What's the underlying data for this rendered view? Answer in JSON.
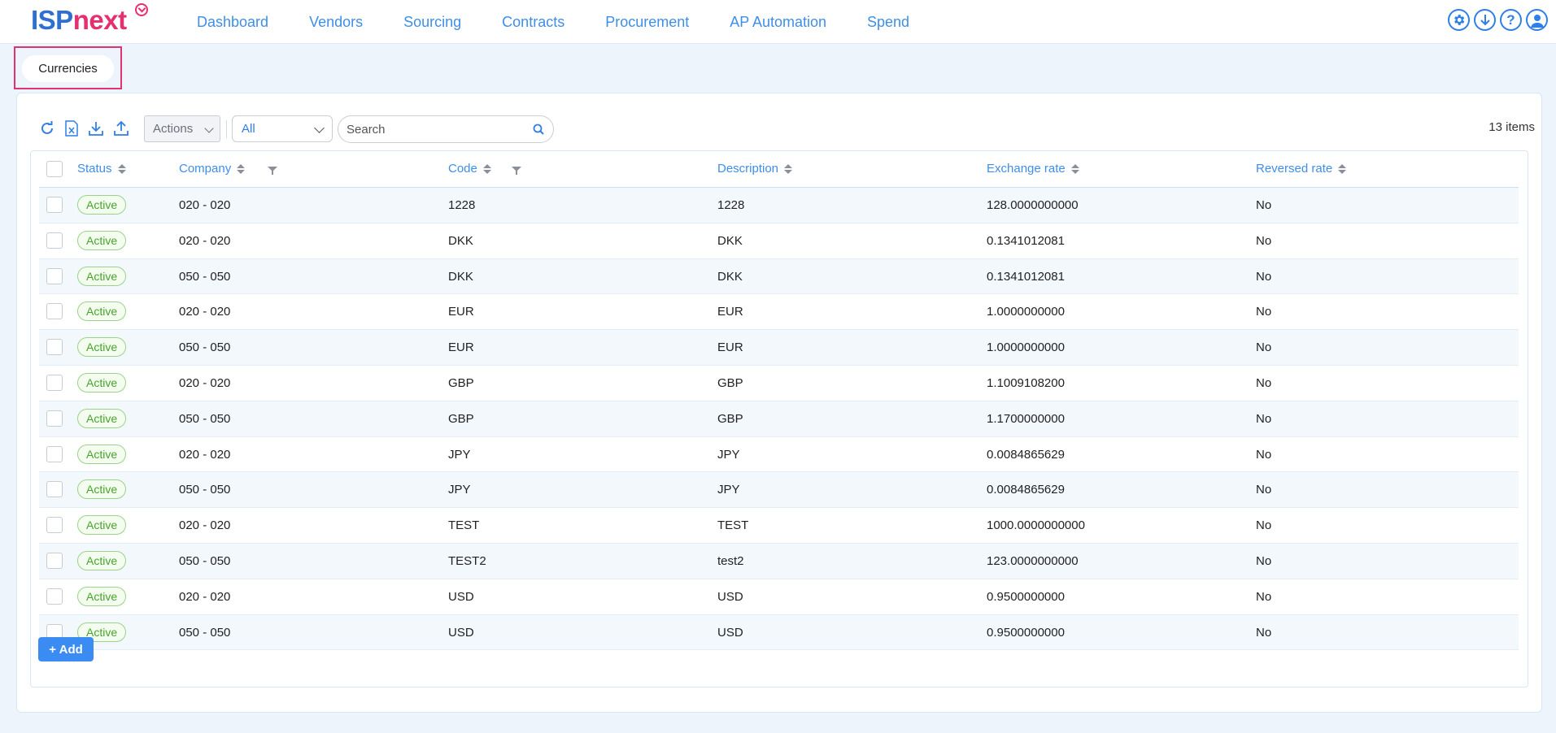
{
  "brand": {
    "part1": "ISP",
    "part2": "next"
  },
  "nav": [
    "Dashboard",
    "Vendors",
    "Sourcing",
    "Contracts",
    "Procurement",
    "AP Automation",
    "Spend"
  ],
  "top_icons": [
    "gear-icon",
    "download-circle-icon",
    "help-icon",
    "user-icon"
  ],
  "page_tab": "Currencies",
  "toolbar": {
    "actions_label": "Actions",
    "filter_value": "All",
    "search_placeholder": "Search",
    "items_count": "13 items",
    "icons": [
      "refresh-icon",
      "excel-export-icon",
      "download-icon",
      "upload-icon"
    ]
  },
  "table": {
    "columns": [
      "Status",
      "Company",
      "Code",
      "Description",
      "Exchange rate",
      "Reversed rate"
    ],
    "rows": [
      [
        "Active",
        "020 - 020",
        "1228",
        "1228",
        "128.0000000000",
        "No"
      ],
      [
        "Active",
        "020 - 020",
        "DKK",
        "DKK",
        "0.1341012081",
        "No"
      ],
      [
        "Active",
        "050 - 050",
        "DKK",
        "DKK",
        "0.1341012081",
        "No"
      ],
      [
        "Active",
        "020 - 020",
        "EUR",
        "EUR",
        "1.0000000000",
        "No"
      ],
      [
        "Active",
        "050 - 050",
        "EUR",
        "EUR",
        "1.0000000000",
        "No"
      ],
      [
        "Active",
        "020 - 020",
        "GBP",
        "GBP",
        "1.1009108200",
        "No"
      ],
      [
        "Active",
        "050 - 050",
        "GBP",
        "GBP",
        "1.1700000000",
        "No"
      ],
      [
        "Active",
        "020 - 020",
        "JPY",
        "JPY",
        "0.0084865629",
        "No"
      ],
      [
        "Active",
        "050 - 050",
        "JPY",
        "JPY",
        "0.0084865629",
        "No"
      ],
      [
        "Active",
        "020 - 020",
        "TEST",
        "TEST",
        "1000.0000000000",
        "No"
      ],
      [
        "Active",
        "050 - 050",
        "TEST2",
        "test2",
        "123.0000000000",
        "No"
      ],
      [
        "Active",
        "020 - 020",
        "USD",
        "USD",
        "0.9500000000",
        "No"
      ],
      [
        "Active",
        "050 - 050",
        "USD",
        "USD",
        "0.9500000000",
        "No"
      ]
    ]
  },
  "add_button": "+ Add",
  "colors": {
    "accent": "#2f7fe6",
    "brand_blue": "#2f6fd0",
    "brand_pink": "#e5306f",
    "active_green": "#47a52a"
  }
}
